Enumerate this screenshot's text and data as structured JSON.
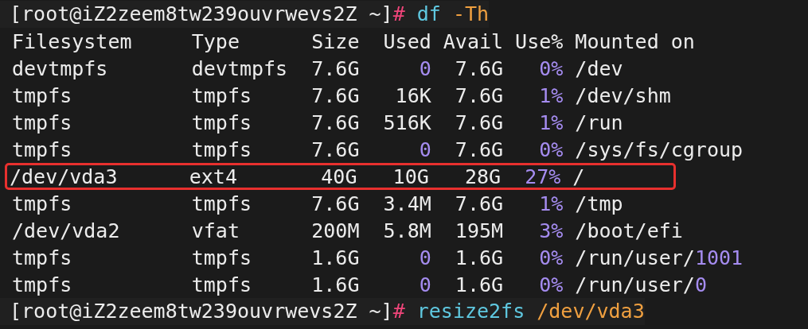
{
  "terminal": {
    "lines": [
      {
        "kind": "prompt",
        "tokens": [
          {
            "text": "[root@iZ2zeem8tw239ouvrwevs2Z ~]",
            "kind": "prompt"
          },
          {
            "text": "#",
            "kind": "hash"
          },
          {
            "text": "df",
            "kind": "command"
          },
          {
            "text": "-Th",
            "kind": "argument"
          }
        ]
      },
      {
        "kind": "header",
        "cells": [
          [
            {
              "text": "Filesystem",
              "kind": "plain"
            }
          ],
          [
            {
              "text": "Type",
              "kind": "plain"
            }
          ],
          [
            {
              "text": "Size",
              "kind": "plain"
            }
          ],
          [
            {
              "text": "Used",
              "kind": "plain"
            }
          ],
          [
            {
              "text": "Avail",
              "kind": "plain"
            }
          ],
          [
            {
              "text": "Use%",
              "kind": "plain"
            }
          ],
          [
            {
              "text": "Mounted on",
              "kind": "plain"
            }
          ]
        ]
      },
      {
        "kind": "row",
        "highlighted": false,
        "cells": [
          [
            {
              "text": "devtmpfs",
              "kind": "plain"
            }
          ],
          [
            {
              "text": "devtmpfs",
              "kind": "plain"
            }
          ],
          [
            {
              "text": "7.6G",
              "kind": "plain"
            }
          ],
          [
            {
              "text": "0",
              "kind": "number"
            }
          ],
          [
            {
              "text": "7.6G",
              "kind": "plain"
            }
          ],
          [
            {
              "text": "0%",
              "kind": "number"
            }
          ],
          [
            {
              "text": "/dev",
              "kind": "plain"
            }
          ]
        ]
      },
      {
        "kind": "row",
        "highlighted": false,
        "cells": [
          [
            {
              "text": "tmpfs",
              "kind": "plain"
            }
          ],
          [
            {
              "text": "tmpfs",
              "kind": "plain"
            }
          ],
          [
            {
              "text": "7.6G",
              "kind": "plain"
            }
          ],
          [
            {
              "text": "16K",
              "kind": "plain"
            }
          ],
          [
            {
              "text": "7.6G",
              "kind": "plain"
            }
          ],
          [
            {
              "text": "1%",
              "kind": "number"
            }
          ],
          [
            {
              "text": "/dev/shm",
              "kind": "plain"
            }
          ]
        ]
      },
      {
        "kind": "row",
        "highlighted": false,
        "cells": [
          [
            {
              "text": "tmpfs",
              "kind": "plain"
            }
          ],
          [
            {
              "text": "tmpfs",
              "kind": "plain"
            }
          ],
          [
            {
              "text": "7.6G",
              "kind": "plain"
            }
          ],
          [
            {
              "text": "516K",
              "kind": "plain"
            }
          ],
          [
            {
              "text": "7.6G",
              "kind": "plain"
            }
          ],
          [
            {
              "text": "1%",
              "kind": "number"
            }
          ],
          [
            {
              "text": "/run",
              "kind": "plain"
            }
          ]
        ]
      },
      {
        "kind": "row",
        "highlighted": false,
        "cells": [
          [
            {
              "text": "tmpfs",
              "kind": "plain"
            }
          ],
          [
            {
              "text": "tmpfs",
              "kind": "plain"
            }
          ],
          [
            {
              "text": "7.6G",
              "kind": "plain"
            }
          ],
          [
            {
              "text": "0",
              "kind": "number"
            }
          ],
          [
            {
              "text": "7.6G",
              "kind": "plain"
            }
          ],
          [
            {
              "text": "0%",
              "kind": "number"
            }
          ],
          [
            {
              "text": "/sys/fs/cgroup",
              "kind": "plain"
            }
          ]
        ]
      },
      {
        "kind": "row",
        "highlighted": true,
        "cells": [
          [
            {
              "text": "/dev/vda3",
              "kind": "plain"
            }
          ],
          [
            {
              "text": "ext4",
              "kind": "plain"
            }
          ],
          [
            {
              "text": "40G",
              "kind": "plain"
            }
          ],
          [
            {
              "text": "10G",
              "kind": "plain"
            }
          ],
          [
            {
              "text": "28G",
              "kind": "plain"
            }
          ],
          [
            {
              "text": "27%",
              "kind": "number"
            }
          ],
          [
            {
              "text": "/",
              "kind": "plain"
            }
          ]
        ]
      },
      {
        "kind": "row",
        "highlighted": false,
        "cells": [
          [
            {
              "text": "tmpfs",
              "kind": "plain"
            }
          ],
          [
            {
              "text": "tmpfs",
              "kind": "plain"
            }
          ],
          [
            {
              "text": "7.6G",
              "kind": "plain"
            }
          ],
          [
            {
              "text": "3.4M",
              "kind": "plain"
            }
          ],
          [
            {
              "text": "7.6G",
              "kind": "plain"
            }
          ],
          [
            {
              "text": "1%",
              "kind": "number"
            }
          ],
          [
            {
              "text": "/tmp",
              "kind": "plain"
            }
          ]
        ]
      },
      {
        "kind": "row",
        "highlighted": false,
        "cells": [
          [
            {
              "text": "/dev/vda2",
              "kind": "plain"
            }
          ],
          [
            {
              "text": "vfat",
              "kind": "plain"
            }
          ],
          [
            {
              "text": "200M",
              "kind": "plain"
            }
          ],
          [
            {
              "text": "5.8M",
              "kind": "plain"
            }
          ],
          [
            {
              "text": "195M",
              "kind": "plain"
            }
          ],
          [
            {
              "text": "3%",
              "kind": "number"
            }
          ],
          [
            {
              "text": "/boot/efi",
              "kind": "plain"
            }
          ]
        ]
      },
      {
        "kind": "row",
        "highlighted": false,
        "cells": [
          [
            {
              "text": "tmpfs",
              "kind": "plain"
            }
          ],
          [
            {
              "text": "tmpfs",
              "kind": "plain"
            }
          ],
          [
            {
              "text": "1.6G",
              "kind": "plain"
            }
          ],
          [
            {
              "text": "0",
              "kind": "number"
            }
          ],
          [
            {
              "text": "1.6G",
              "kind": "plain"
            }
          ],
          [
            {
              "text": "0%",
              "kind": "number"
            }
          ],
          [
            {
              "text": "/run/user/",
              "kind": "plain"
            },
            {
              "text": "1001",
              "kind": "number"
            }
          ]
        ]
      },
      {
        "kind": "row",
        "highlighted": false,
        "cells": [
          [
            {
              "text": "tmpfs",
              "kind": "plain"
            }
          ],
          [
            {
              "text": "tmpfs",
              "kind": "plain"
            }
          ],
          [
            {
              "text": "1.6G",
              "kind": "plain"
            }
          ],
          [
            {
              "text": "0",
              "kind": "number"
            }
          ],
          [
            {
              "text": "1.6G",
              "kind": "plain"
            }
          ],
          [
            {
              "text": "0%",
              "kind": "number"
            }
          ],
          [
            {
              "text": "/run/user/",
              "kind": "plain"
            },
            {
              "text": "0",
              "kind": "number"
            }
          ]
        ]
      },
      {
        "kind": "prompt",
        "tokens": [
          {
            "text": "[root@iZ2zeem8tw239ouvrwevs2Z ~]",
            "kind": "prompt"
          },
          {
            "text": "#",
            "kind": "hash"
          },
          {
            "text": "resize2fs",
            "kind": "command"
          },
          {
            "text": "/dev/vda3",
            "kind": "argument"
          }
        ]
      }
    ]
  }
}
